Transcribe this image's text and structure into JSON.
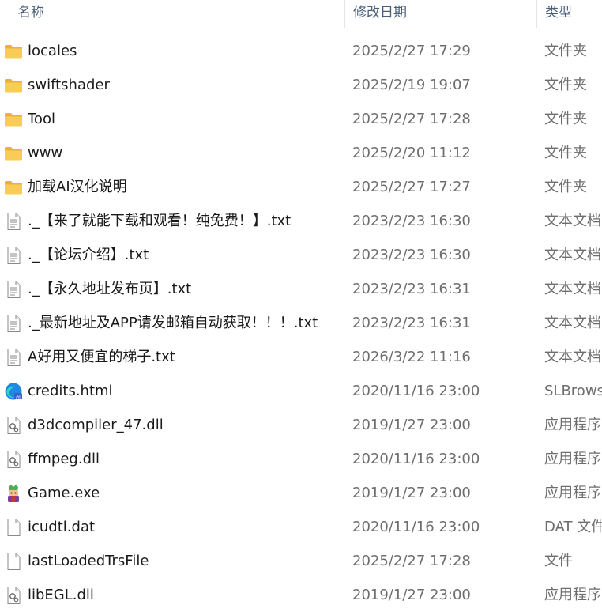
{
  "header": {
    "name_label": "名称",
    "date_label": "修改日期",
    "type_label": "类型",
    "sort_glyph": "^"
  },
  "rows": [
    {
      "name": "locales",
      "date": "2025/2/27 17:29",
      "type": "文件夹",
      "icon": "folder-icon"
    },
    {
      "name": "swiftshader",
      "date": "2025/2/19 19:07",
      "type": "文件夹",
      "icon": "folder-icon"
    },
    {
      "name": "Tool",
      "date": "2025/2/27 17:28",
      "type": "文件夹",
      "icon": "folder-icon"
    },
    {
      "name": "www",
      "date": "2025/2/20 11:12",
      "type": "文件夹",
      "icon": "folder-icon"
    },
    {
      "name": "加载AI汉化说明",
      "date": "2025/2/27 17:27",
      "type": "文件夹",
      "icon": "folder-icon"
    },
    {
      "name": "._【来了就能下载和观看！纯免费！】.txt",
      "date": "2023/2/23 16:30",
      "type": "文本文档",
      "icon": "text-file-icon"
    },
    {
      "name": "._【论坛介绍】.txt",
      "date": "2023/2/23 16:30",
      "type": "文本文档",
      "icon": "text-file-icon"
    },
    {
      "name": "._【永久地址发布页】.txt",
      "date": "2023/2/23 16:31",
      "type": "文本文档",
      "icon": "text-file-icon"
    },
    {
      "name": "._最新地址及APP请发邮箱自动获取！！！.txt",
      "date": "2023/2/23 16:31",
      "type": "文本文档",
      "icon": "text-file-icon"
    },
    {
      "name": "A好用又便宜的梯子.txt",
      "date": "2026/3/22 11:16",
      "type": "文本文档",
      "icon": "text-file-icon"
    },
    {
      "name": "credits.html",
      "date": "2020/11/16 23:00",
      "type": "SLBrowse",
      "icon": "browser-html-icon"
    },
    {
      "name": "d3dcompiler_47.dll",
      "date": "2019/1/27 23:00",
      "type": "应用程序",
      "icon": "dll-file-icon"
    },
    {
      "name": "ffmpeg.dll",
      "date": "2020/11/16 23:00",
      "type": "应用程序",
      "icon": "dll-file-icon"
    },
    {
      "name": "Game.exe",
      "date": "2019/1/27 23:00",
      "type": "应用程序",
      "icon": "game-exe-icon"
    },
    {
      "name": "icudtl.dat",
      "date": "2020/11/16 23:00",
      "type": "DAT 文件",
      "icon": "blank-file-icon"
    },
    {
      "name": "lastLoadedTrsFile",
      "date": "2025/2/27 17:28",
      "type": "文件",
      "icon": "blank-file-icon"
    },
    {
      "name": "libEGL.dll",
      "date": "2019/1/27 23:00",
      "type": "应用程序",
      "icon": "dll-file-icon"
    }
  ],
  "colors": {
    "folder": "#f5c84a",
    "header_text": "#4c607a",
    "secondary_text": "#6d6d6d"
  }
}
